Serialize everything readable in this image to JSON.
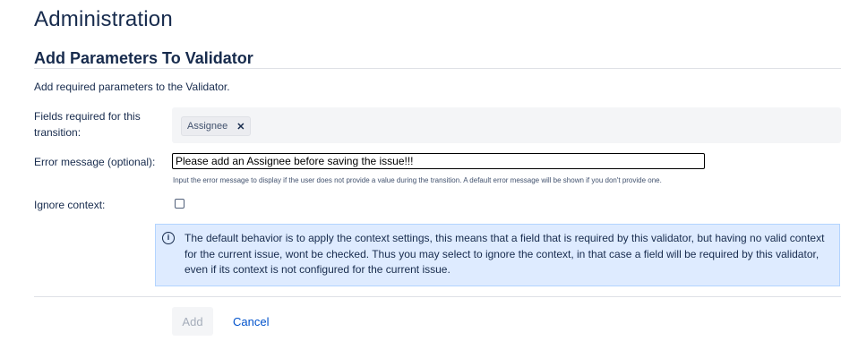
{
  "page": {
    "title": "Administration",
    "section_title": "Add Parameters To Validator",
    "description": "Add required parameters to the Validator."
  },
  "form": {
    "fields_label": "Fields required for this transition:",
    "selected_field": "Assignee",
    "remove_icon": "close-icon",
    "error_label": "Error message (optional):",
    "error_value": "Please add an Assignee before saving the issue!!!",
    "error_help": "Input the error message to display if the user does not provide a value during the transition. A default error message will be shown if you don't provide one.",
    "ignore_label": "Ignore context:",
    "ignore_checked": false
  },
  "info": {
    "icon": "info-icon",
    "text": "The default behavior is to apply the context settings, this means that a field that is required by this validator, but having no valid context for the current issue, wont be checked. Thus you may select to ignore the context, in that case a field will be required by this validator, even if its context is not configured for the current issue."
  },
  "actions": {
    "add_label": "Add",
    "cancel_label": "Cancel"
  },
  "colors": {
    "info_background": "#deebff",
    "info_border": "#b3d4ff",
    "link": "#0052cc",
    "text": "#172b4d"
  }
}
